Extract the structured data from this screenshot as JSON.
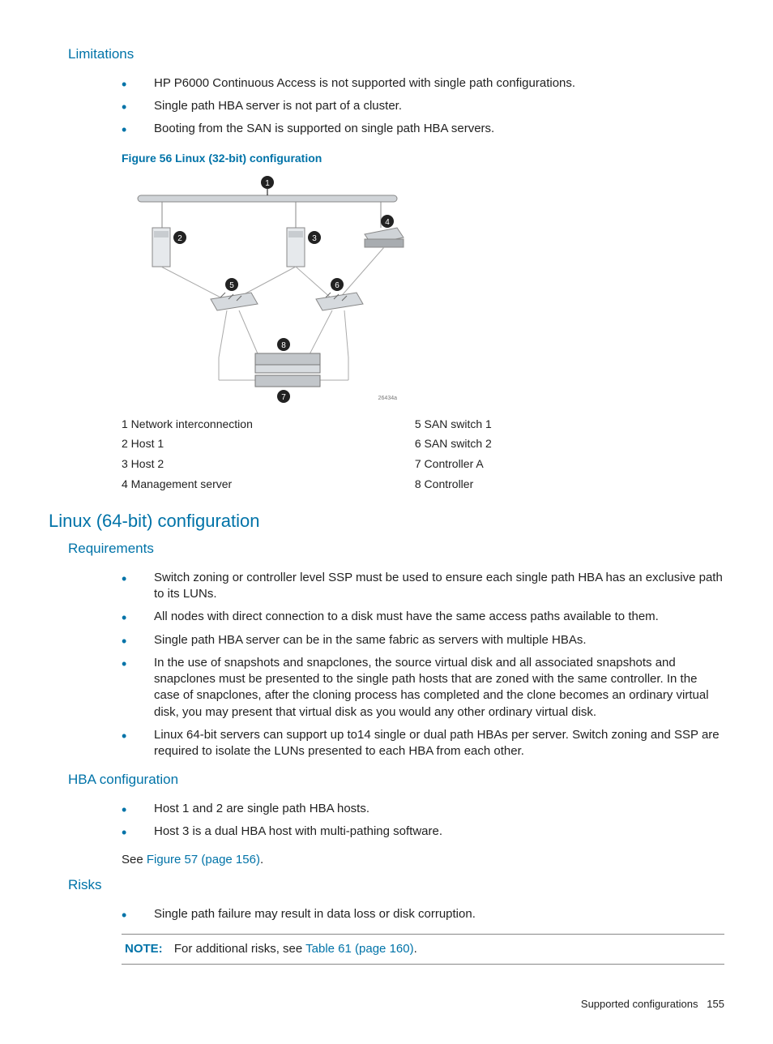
{
  "sections": {
    "limitations": {
      "heading": "Limitations",
      "items": [
        "HP P6000 Continuous Access is not supported with single path configurations.",
        "Single path HBA server is not part of a cluster.",
        "Booting from the SAN is supported on single path HBA servers."
      ]
    },
    "figure56": {
      "caption": "Figure 56 Linux (32-bit) configuration",
      "diagram_id": "26434a",
      "legend_left": [
        "1 Network interconnection",
        "2 Host 1",
        "3 Host 2",
        "4 Management server"
      ],
      "legend_right": [
        "5 SAN switch 1",
        "6 SAN switch 2",
        "7 Controller A",
        "8 Controller"
      ]
    },
    "linux64": {
      "heading": "Linux (64-bit) configuration"
    },
    "requirements": {
      "heading": "Requirements",
      "items": [
        "Switch zoning or controller level SSP must be used to ensure each single path HBA has an exclusive path to its LUNs.",
        "All nodes with direct connection to a disk must have the same access paths available to them.",
        "Single path HBA server can be in the same fabric as servers with multiple HBAs.",
        "In the use of snapshots and snapclones, the source virtual disk and all associated snapshots and snapclones must be presented to the single path hosts that are zoned with the same controller. In the case of snapclones, after the cloning process has completed and the clone becomes an ordinary virtual disk, you may present that virtual disk as you would any other ordinary virtual disk.",
        "Linux 64-bit servers can support up to14 single or dual path HBAs per server. Switch zoning and SSP are required to isolate the LUNs presented to each HBA from each other."
      ]
    },
    "hba": {
      "heading": "HBA configuration",
      "items": [
        "Host 1 and 2 are single path HBA hosts.",
        "Host 3 is a dual HBA host with multi-pathing software."
      ],
      "see_prefix": "See ",
      "see_link": "Figure 57 (page 156)",
      "see_suffix": "."
    },
    "risks": {
      "heading": "Risks",
      "items": [
        "Single path failure may result in data loss or disk corruption."
      ],
      "note_label": "NOTE:",
      "note_prefix": "For additional risks, see ",
      "note_link": "Table 61 (page 160)",
      "note_suffix": "."
    },
    "footer": {
      "text": "Supported configurations",
      "page": "155"
    }
  }
}
